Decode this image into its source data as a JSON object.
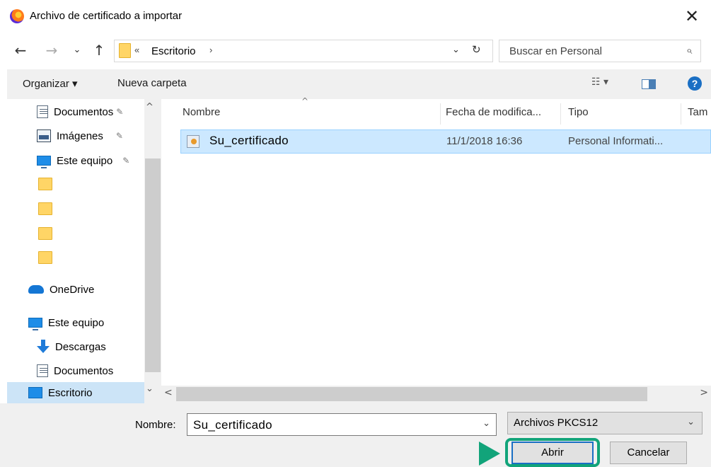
{
  "window": {
    "title": "Archivo de certificado a importar",
    "close_glyph": "✕",
    "icon": "firefox-icon"
  },
  "nav": {
    "back": "←",
    "forward": "→",
    "recent": "⌄",
    "up": "↑"
  },
  "address": {
    "prefix": "«",
    "path": "Escritorio",
    "sep": "›",
    "dropdown": "⌄",
    "refresh": "↻"
  },
  "search": {
    "placeholder": "Buscar en Personal",
    "icon": "⌕"
  },
  "toolbar": {
    "organizar": "Organizar ▾",
    "nueva_carpeta": "Nueva carpeta",
    "view": "☷ ▾",
    "help": "?"
  },
  "sidebar": {
    "items": [
      {
        "label": "Documentos",
        "pinned": true
      },
      {
        "label": "Imágenes",
        "pinned": true
      },
      {
        "label": "Este equipo",
        "pinned": true
      },
      {
        "label": ""
      },
      {
        "label": ""
      },
      {
        "label": ""
      },
      {
        "label": ""
      },
      {
        "label": "OneDrive"
      },
      {
        "label": "Este equipo"
      },
      {
        "label": "Descargas"
      },
      {
        "label": "Documentos"
      },
      {
        "label": "Escritorio",
        "selected": true
      }
    ],
    "pin_glyph": "✎"
  },
  "columns": {
    "name": "Nombre",
    "date": "Fecha de modifica...",
    "type": "Tipo",
    "size": "Tam",
    "sort_glyph": "^"
  },
  "files": [
    {
      "name": "Su_certificado",
      "date": "11/1/2018 16:36",
      "type": "Personal Informati..."
    }
  ],
  "scroll": {
    "up": "^",
    "down": "⌄",
    "left": "<",
    "right": ">"
  },
  "footer": {
    "name_label": "Nombre:",
    "name_value": "Su_certificado",
    "name_dropdown": "⌄",
    "filter_value": "Archivos PKCS12",
    "filter_dropdown": "⌄",
    "open_button": "Abrir",
    "cancel_button": "Cancelar"
  },
  "colors": {
    "accent": "#12a47a",
    "selection": "#cce8ff",
    "toolbar_bg": "#f0f0f0"
  }
}
